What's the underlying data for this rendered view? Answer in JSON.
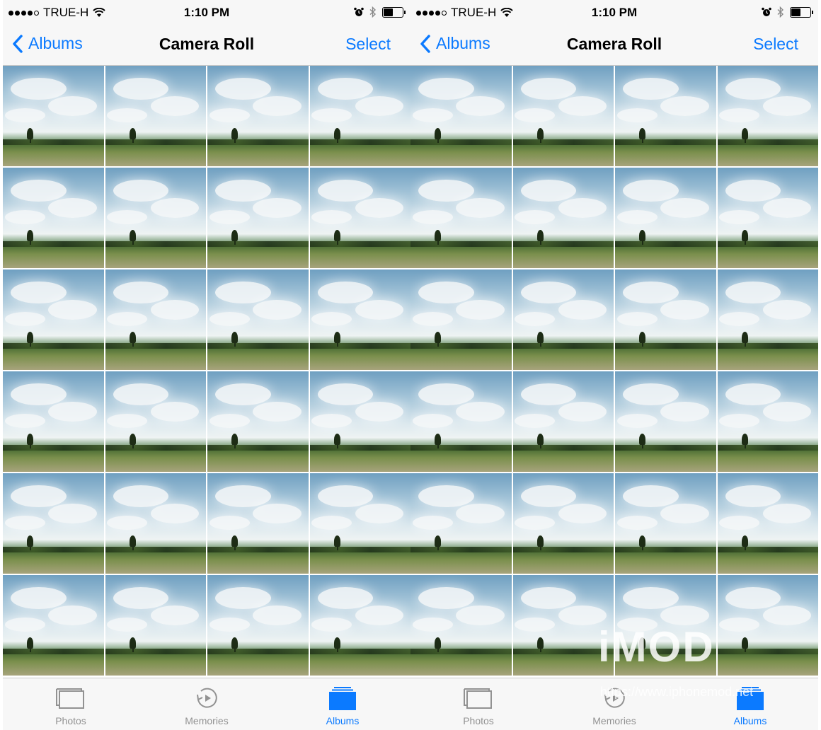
{
  "left": {
    "status": {
      "carrier": "TRUE-H",
      "time": "1:10 PM"
    },
    "nav": {
      "back_label": "Albums",
      "title": "Camera Roll",
      "select_label": "Select"
    },
    "tabs": [
      {
        "label": "Photos",
        "icon": "photos-icon"
      },
      {
        "label": "Memories",
        "icon": "memories-icon"
      },
      {
        "label": "Albums",
        "icon": "albums-icon"
      }
    ]
  },
  "right": {
    "status": {
      "carrier": "TRUE-H",
      "time": "1:10 PM"
    },
    "nav": {
      "back_label": "Albums",
      "title": "Camera Roll",
      "select_label": "Select"
    },
    "tabs": [
      {
        "label": "Photos",
        "icon": "photos-icon"
      },
      {
        "label": "Memories",
        "icon": "memories-icon"
      },
      {
        "label": "Albums",
        "icon": "albums-icon"
      }
    ]
  },
  "grid": {
    "columns": 4,
    "rows": 6
  },
  "watermark": {
    "logo": "iMOD",
    "url": "https://www.iphonemod.net"
  },
  "colors": {
    "accent": "#0b7aff",
    "inactive_tab": "#929292",
    "bar_bg": "#f7f7f7"
  }
}
